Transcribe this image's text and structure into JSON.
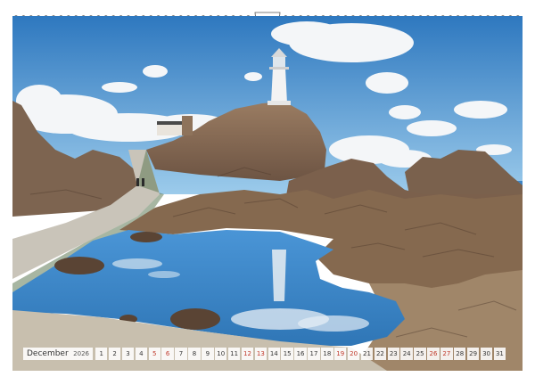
{
  "calendar": {
    "month": "December",
    "year": "2026",
    "days": [
      {
        "n": "1",
        "weekend": false
      },
      {
        "n": "2",
        "weekend": false
      },
      {
        "n": "3",
        "weekend": false
      },
      {
        "n": "4",
        "weekend": false
      },
      {
        "n": "5",
        "weekend": true
      },
      {
        "n": "6",
        "weekend": true
      },
      {
        "n": "7",
        "weekend": false
      },
      {
        "n": "8",
        "weekend": false
      },
      {
        "n": "9",
        "weekend": false
      },
      {
        "n": "10",
        "weekend": false
      },
      {
        "n": "11",
        "weekend": false
      },
      {
        "n": "12",
        "weekend": true
      },
      {
        "n": "13",
        "weekend": true
      },
      {
        "n": "14",
        "weekend": false
      },
      {
        "n": "15",
        "weekend": false
      },
      {
        "n": "16",
        "weekend": false
      },
      {
        "n": "17",
        "weekend": false
      },
      {
        "n": "18",
        "weekend": false
      },
      {
        "n": "19",
        "weekend": true
      },
      {
        "n": "20",
        "weekend": true
      },
      {
        "n": "21",
        "weekend": false
      },
      {
        "n": "22",
        "weekend": false
      },
      {
        "n": "23",
        "weekend": false
      },
      {
        "n": "24",
        "weekend": false
      },
      {
        "n": "25",
        "weekend": false
      },
      {
        "n": "26",
        "weekend": true
      },
      {
        "n": "27",
        "weekend": true
      },
      {
        "n": "28",
        "weekend": false
      },
      {
        "n": "29",
        "weekend": false
      },
      {
        "n": "30",
        "weekend": false
      },
      {
        "n": "31",
        "weekend": false
      }
    ]
  },
  "colors": {
    "sky_top": "#2f7fc4",
    "sky_bottom": "#8cc3e8",
    "rock": "#8a6f58",
    "rock_dark": "#5b4535",
    "water": "#3f8ed2",
    "weekend": "#c0392b"
  },
  "photo": {
    "subject": "lighthouse-on-rocky-coast"
  }
}
